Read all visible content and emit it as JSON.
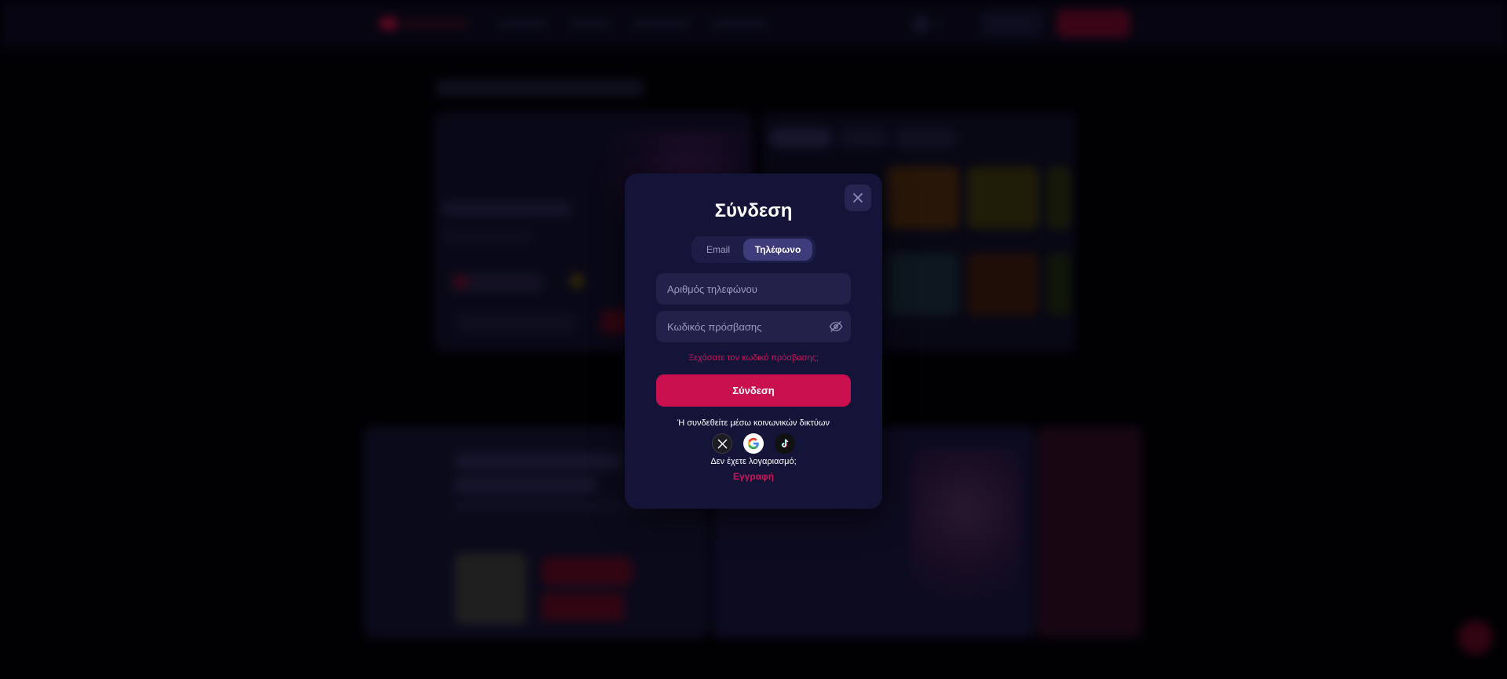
{
  "colors": {
    "modal_bg": "#141338",
    "accent": "#c8104f",
    "accent_text": "#c81759",
    "field_bg": "#222149",
    "tab_active_bg": "#3f3c7c"
  },
  "modal": {
    "title": "Σύνδεση",
    "close_icon": "close-icon",
    "tabs": [
      {
        "label": "Email",
        "active": false
      },
      {
        "label": "Τηλέφωνο",
        "active": true
      }
    ],
    "phone_placeholder": "Αριθμός τηλεφώνου",
    "password_placeholder": "Κωδικός πρόσβασης",
    "password_toggle_icon": "eye-off-icon",
    "forgot_password": "Ξεχάσατε τον κωδικό πρόσβασης;",
    "submit_label": "Σύνδεση",
    "social_text": "Ή συνδεθείτε μέσω κοινωνικών δικτύων",
    "social_icons": [
      "x-icon",
      "google-icon",
      "tiktok-icon"
    ],
    "no_account_text": "Δεν έχετε λογαριασμό;",
    "register_label": "Εγγραφή"
  }
}
